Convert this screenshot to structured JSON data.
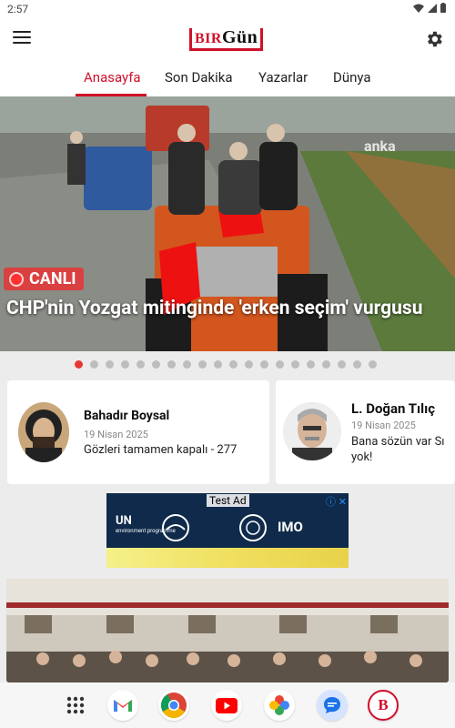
{
  "status": {
    "time": "2:57"
  },
  "app": {
    "logo_prefix": "BIR",
    "logo_main": "Gün"
  },
  "tabs": [
    {
      "label": "Anasayfa",
      "active": true
    },
    {
      "label": "Son Dakika",
      "active": false
    },
    {
      "label": "Yazarlar",
      "active": false
    },
    {
      "label": "Dünya",
      "active": false
    }
  ],
  "hero": {
    "badge": "CANLI",
    "title": "CHP'nin Yozgat mitinginde 'erken seçim' vurgusu",
    "watermark": "anka",
    "slide_count": 20,
    "active_slide": 0
  },
  "authors": [
    {
      "name": "Bahadır Boysal",
      "date": "19 Nisan 2025",
      "title": "Gözleri tamamen kapalı - 277"
    },
    {
      "name": "L.  Doğan Tılıç",
      "date": "19 Nisan 2025",
      "title": "Bana sözün var Sı yok!"
    }
  ],
  "ad": {
    "label": "Test Ad",
    "close": "ⓘ ✕",
    "brand_un": "UN",
    "brand_un_sub": "environment programme",
    "brand_imo": "IMO"
  },
  "dock": [
    "apps-grid-icon",
    "gmail-icon",
    "chrome-icon",
    "youtube-icon",
    "photos-icon",
    "messages-icon",
    "birgun-app-icon"
  ],
  "colors": {
    "accent": "#d0102a",
    "live": "#d94141"
  }
}
